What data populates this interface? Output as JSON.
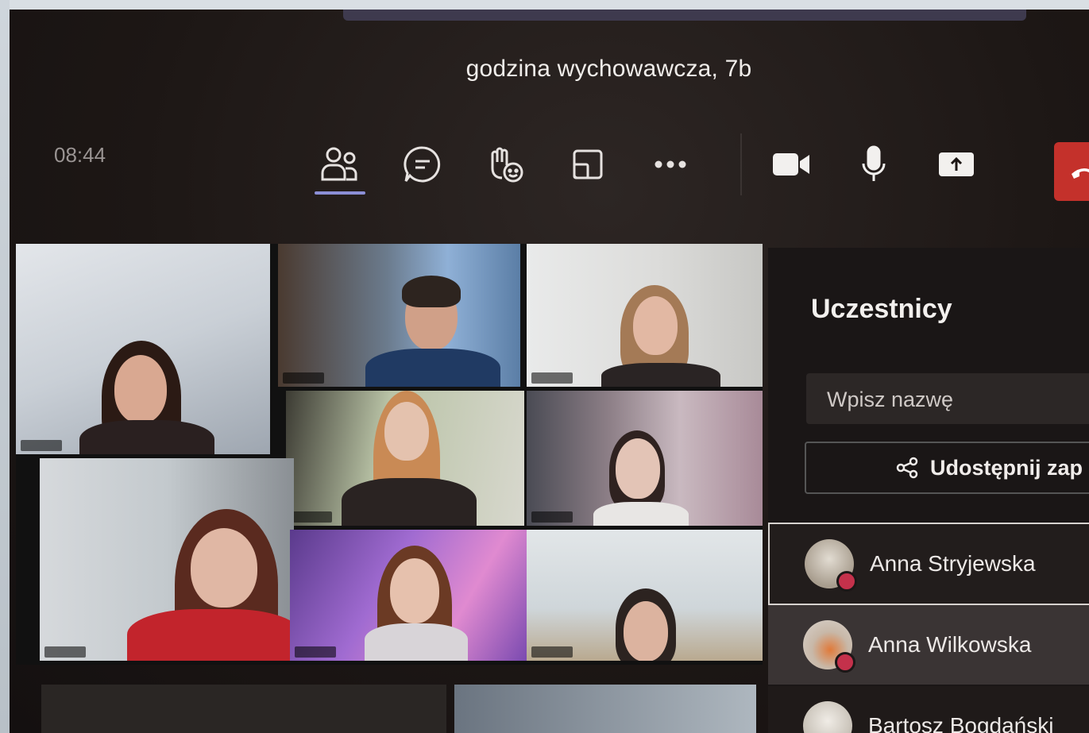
{
  "meeting": {
    "title": "godzina wychowawcza, 7b",
    "clock": "08:44"
  },
  "toolbar": {
    "items": [
      {
        "icon": "people-icon",
        "label": "Uczestnicy"
      },
      {
        "icon": "chat-icon",
        "label": "Czat"
      },
      {
        "icon": "raise-hand-icon",
        "label": "Podnieś rękę"
      },
      {
        "icon": "rooms-icon",
        "label": "Pokoje"
      },
      {
        "icon": "more-icon",
        "label": "Więcej"
      }
    ],
    "media": [
      {
        "icon": "camera-icon"
      },
      {
        "icon": "mic-icon"
      },
      {
        "icon": "share-screen-icon"
      }
    ],
    "leave_icon": "hangup-icon"
  },
  "participants_panel": {
    "title": "Uczestnicy",
    "search_placeholder": "Wpisz nazwę",
    "share_label": "Udostępnij zap",
    "participants": [
      {
        "name": "Anna Stryjewska"
      },
      {
        "name": "Anna Wilkowska"
      },
      {
        "name": "Bartosz Bogdański"
      }
    ]
  },
  "colors": {
    "accent": "#8c8fd6",
    "leave": "#c4312b",
    "status_dot": "#c4314b"
  }
}
